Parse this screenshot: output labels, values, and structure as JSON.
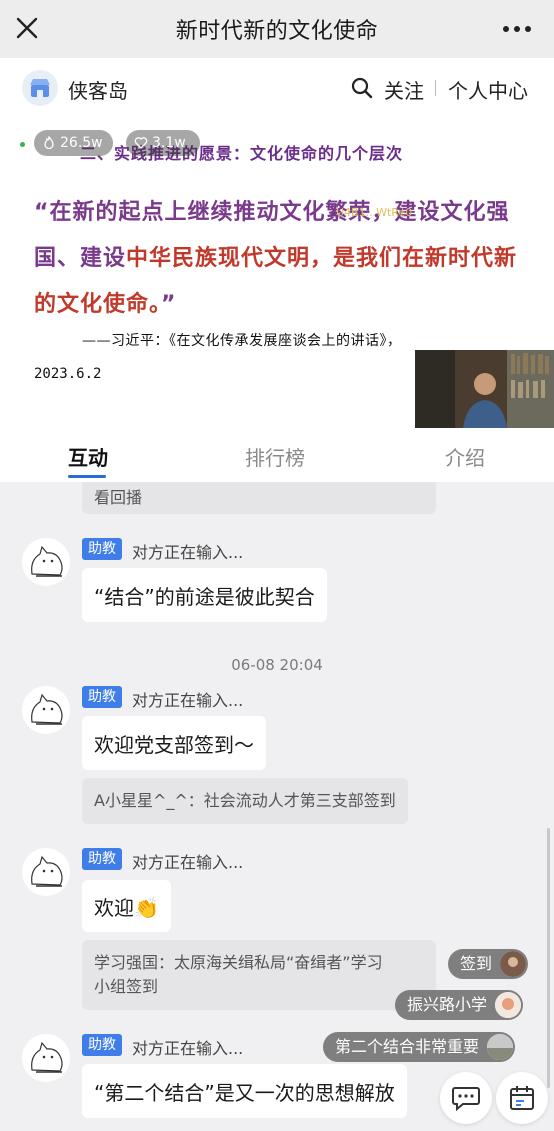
{
  "window": {
    "title": "新时代新的文化使命"
  },
  "header": {
    "brand": "侠客岛",
    "follow_label": "关注",
    "center_label": "个人中心"
  },
  "video": {
    "views": "26.5w",
    "likes": "3.1w",
    "section_heading": "二、实践推进的愿景：文化使命的几个层次",
    "quote_part1": "“在新的起点上继续推动文化繁荣，建设文化强国、建设",
    "quote_part2": "中华民族现代文明，是我们在新时代新的文化使命。",
    "quote_part3": "”",
    "attribution": "——习近平：《在文化传承发展座谈会上的讲话》，",
    "date": "2023.6.2",
    "watermark": "U4B1...WtRe0"
  },
  "tabs": [
    {
      "label": "互动"
    },
    {
      "label": "排行榜"
    },
    {
      "label": "介绍"
    }
  ],
  "chat": {
    "replay_text": "看回播",
    "timestamp": "06-08 20:04",
    "messages": [
      {
        "badge": "助教",
        "status": "对方正在输入...",
        "text": "“结合”的前途是彼此契合"
      },
      {
        "badge": "助教",
        "status": "对方正在输入...",
        "text": "欢迎党支部签到～",
        "quote": "A小星星^_^：社会流动人才第三支部签到"
      },
      {
        "badge": "助教",
        "status": "对方正在输入...",
        "text": "欢迎👏",
        "quote_line1": "学习强国：太原海关缉私局“奋缉者”学习",
        "quote_line2": "小组签到"
      },
      {
        "badge": "助教",
        "status": "对方正在输入...",
        "text": "“第二个结合”是又一次的思想解放"
      }
    ]
  },
  "floating": [
    {
      "text": "签到"
    },
    {
      "text": "振兴路小学"
    },
    {
      "text": "第二个结合非常重要"
    }
  ],
  "colors": {
    "accent": "#3f7ee8",
    "quote_purple": "#7a3a8c",
    "quote_red": "#c0392b"
  }
}
